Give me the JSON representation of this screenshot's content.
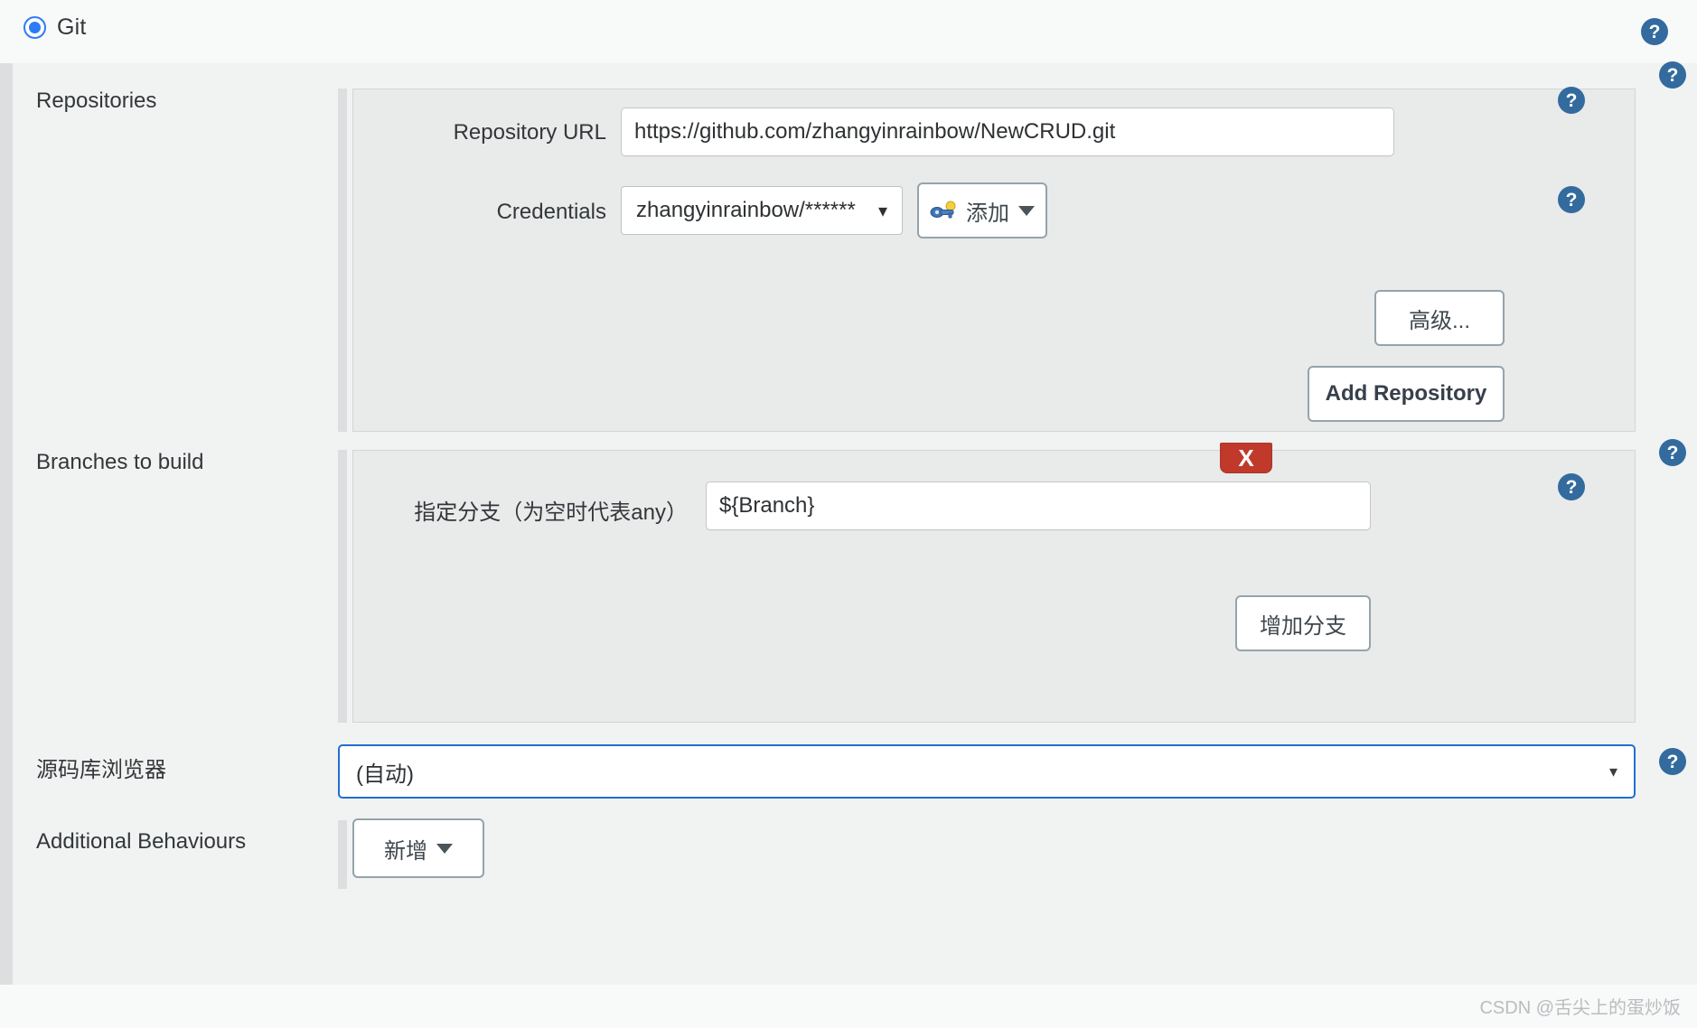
{
  "scm": {
    "selected_label": "Git",
    "radio_icon": "radio-selected-icon",
    "accent_color": "#2d7cf6"
  },
  "help_icon": {
    "glyph": "?",
    "color": "#336b9e",
    "name": "help-icon"
  },
  "repositories": {
    "section_label": "Repositories",
    "repository_url": {
      "label": "Repository URL",
      "value": "https://github.com/zhangyinrainbow/NewCRUD.git"
    },
    "credentials": {
      "label": "Credentials",
      "value": "zhangyinrainbow/******",
      "caret_icon": "chevron-down-icon"
    },
    "add_credentials_button": {
      "label": "添加",
      "icon": "key-icon",
      "caret_icon": "caret-down-icon"
    },
    "advanced_button": "高级...",
    "add_repository_button": "Add Repository"
  },
  "branches": {
    "section_label": "Branches to build",
    "branch_specifier": {
      "label": "指定分支（为空时代表any）",
      "value": "${Branch}"
    },
    "delete_button": "X",
    "add_branch_button": "增加分支"
  },
  "source_browser": {
    "section_label": "源码库浏览器",
    "selected": "(自动)",
    "caret_icon": "chevron-down-icon"
  },
  "additional_behaviours": {
    "section_label": "Additional Behaviours",
    "add_button": {
      "label": "新增",
      "caret_icon": "caret-down-icon"
    }
  },
  "watermark": "CSDN @舌尖上的蛋炒饭"
}
